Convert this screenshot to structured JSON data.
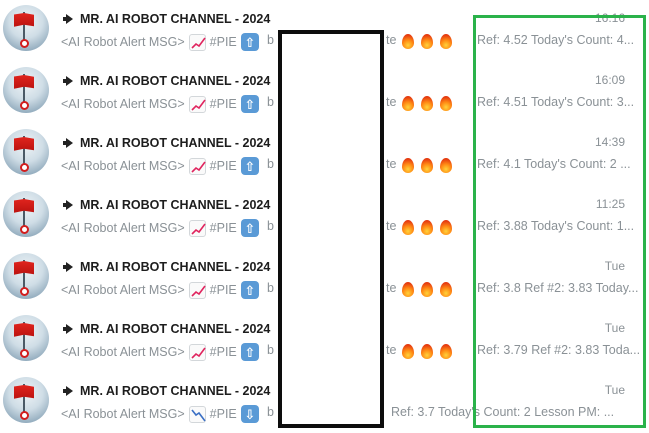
{
  "chats": [
    {
      "title": "MR. AI ROBOT CHANNEL - 2024",
      "time": "16:16",
      "prefix": "<AI Robot Alert MSG>",
      "ticker": "#PIE",
      "frag_b": "b",
      "frag_te": "te",
      "direction": "up",
      "trend": "up",
      "fires": 3,
      "ref": "Ref: 4.52 Today's Count: 4..."
    },
    {
      "title": "MR. AI ROBOT CHANNEL - 2024",
      "time": "16:09",
      "prefix": "<AI Robot Alert MSG>",
      "ticker": "#PIE",
      "frag_b": "b",
      "frag_te": "te",
      "direction": "up",
      "trend": "up",
      "fires": 3,
      "ref": "Ref: 4.51 Today's Count: 3..."
    },
    {
      "title": "MR. AI ROBOT CHANNEL - 2024",
      "time": "14:39",
      "prefix": "<AI Robot Alert MSG>",
      "ticker": "#PIE",
      "frag_b": "b",
      "frag_te": "te",
      "direction": "up",
      "trend": "up",
      "fires": 3,
      "ref": "Ref: 4.1 Today's Count: 2 ..."
    },
    {
      "title": "MR. AI ROBOT CHANNEL - 2024",
      "time": "11:25",
      "prefix": "<AI Robot Alert MSG>",
      "ticker": "#PIE",
      "frag_b": "b",
      "frag_te": "te",
      "direction": "up",
      "trend": "up",
      "fires": 3,
      "ref": "Ref: 3.88 Today's Count: 1..."
    },
    {
      "title": "MR. AI ROBOT CHANNEL - 2024",
      "time": "Tue",
      "prefix": "<AI Robot Alert MSG>",
      "ticker": "#PIE",
      "frag_b": "b",
      "frag_te": "te",
      "direction": "up",
      "trend": "up",
      "fires": 3,
      "ref": "Ref: 3.8 Ref #2: 3.83 Today..."
    },
    {
      "title": "MR. AI ROBOT CHANNEL - 2024",
      "time": "Tue",
      "prefix": "<AI Robot Alert MSG>",
      "ticker": "#PIE",
      "frag_b": "b",
      "frag_te": "te",
      "direction": "up",
      "trend": "up",
      "fires": 3,
      "ref": "Ref: 3.79 Ref #2: 3.83 Toda..."
    },
    {
      "title": "MR. AI ROBOT CHANNEL - 2024",
      "time": "Tue",
      "prefix": "<AI Robot Alert MSG>",
      "ticker": "#PIE",
      "frag_b": "b",
      "frag_te": "",
      "direction": "down",
      "trend": "down",
      "fires": 0,
      "ref": "Ref: 3.7 Today's Count: 2 Lesson PM: ..."
    }
  ],
  "colors": {
    "redaction_border": "#0d0d0d",
    "highlight_border": "#2ab24a",
    "arrow_bg": "#5a9ad6",
    "muted_text": "#8a9196"
  },
  "icons": {
    "megaphone": "megaphone-icon",
    "chart_up": "chart-increasing-icon",
    "chart_down": "chart-decreasing-icon",
    "arrow_up": "up-arrow-icon",
    "arrow_down": "down-arrow-icon",
    "fire": "fire-icon"
  }
}
